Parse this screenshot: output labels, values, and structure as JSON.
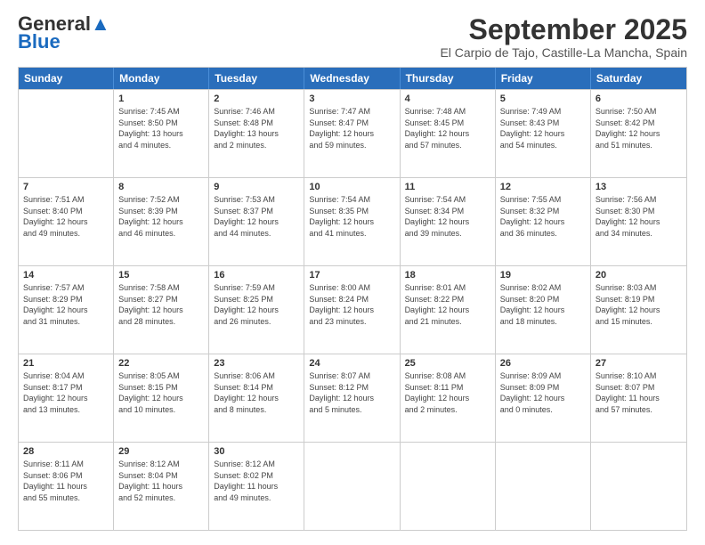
{
  "header": {
    "logo_line1": "General",
    "logo_line2": "Blue",
    "month": "September 2025",
    "location": "El Carpio de Tajo, Castille-La Mancha, Spain"
  },
  "days_of_week": [
    "Sunday",
    "Monday",
    "Tuesday",
    "Wednesday",
    "Thursday",
    "Friday",
    "Saturday"
  ],
  "weeks": [
    [
      {
        "day": "",
        "info": ""
      },
      {
        "day": "1",
        "info": "Sunrise: 7:45 AM\nSunset: 8:50 PM\nDaylight: 13 hours\nand 4 minutes."
      },
      {
        "day": "2",
        "info": "Sunrise: 7:46 AM\nSunset: 8:48 PM\nDaylight: 13 hours\nand 2 minutes."
      },
      {
        "day": "3",
        "info": "Sunrise: 7:47 AM\nSunset: 8:47 PM\nDaylight: 12 hours\nand 59 minutes."
      },
      {
        "day": "4",
        "info": "Sunrise: 7:48 AM\nSunset: 8:45 PM\nDaylight: 12 hours\nand 57 minutes."
      },
      {
        "day": "5",
        "info": "Sunrise: 7:49 AM\nSunset: 8:43 PM\nDaylight: 12 hours\nand 54 minutes."
      },
      {
        "day": "6",
        "info": "Sunrise: 7:50 AM\nSunset: 8:42 PM\nDaylight: 12 hours\nand 51 minutes."
      }
    ],
    [
      {
        "day": "7",
        "info": "Sunrise: 7:51 AM\nSunset: 8:40 PM\nDaylight: 12 hours\nand 49 minutes."
      },
      {
        "day": "8",
        "info": "Sunrise: 7:52 AM\nSunset: 8:39 PM\nDaylight: 12 hours\nand 46 minutes."
      },
      {
        "day": "9",
        "info": "Sunrise: 7:53 AM\nSunset: 8:37 PM\nDaylight: 12 hours\nand 44 minutes."
      },
      {
        "day": "10",
        "info": "Sunrise: 7:54 AM\nSunset: 8:35 PM\nDaylight: 12 hours\nand 41 minutes."
      },
      {
        "day": "11",
        "info": "Sunrise: 7:54 AM\nSunset: 8:34 PM\nDaylight: 12 hours\nand 39 minutes."
      },
      {
        "day": "12",
        "info": "Sunrise: 7:55 AM\nSunset: 8:32 PM\nDaylight: 12 hours\nand 36 minutes."
      },
      {
        "day": "13",
        "info": "Sunrise: 7:56 AM\nSunset: 8:30 PM\nDaylight: 12 hours\nand 34 minutes."
      }
    ],
    [
      {
        "day": "14",
        "info": "Sunrise: 7:57 AM\nSunset: 8:29 PM\nDaylight: 12 hours\nand 31 minutes."
      },
      {
        "day": "15",
        "info": "Sunrise: 7:58 AM\nSunset: 8:27 PM\nDaylight: 12 hours\nand 28 minutes."
      },
      {
        "day": "16",
        "info": "Sunrise: 7:59 AM\nSunset: 8:25 PM\nDaylight: 12 hours\nand 26 minutes."
      },
      {
        "day": "17",
        "info": "Sunrise: 8:00 AM\nSunset: 8:24 PM\nDaylight: 12 hours\nand 23 minutes."
      },
      {
        "day": "18",
        "info": "Sunrise: 8:01 AM\nSunset: 8:22 PM\nDaylight: 12 hours\nand 21 minutes."
      },
      {
        "day": "19",
        "info": "Sunrise: 8:02 AM\nSunset: 8:20 PM\nDaylight: 12 hours\nand 18 minutes."
      },
      {
        "day": "20",
        "info": "Sunrise: 8:03 AM\nSunset: 8:19 PM\nDaylight: 12 hours\nand 15 minutes."
      }
    ],
    [
      {
        "day": "21",
        "info": "Sunrise: 8:04 AM\nSunset: 8:17 PM\nDaylight: 12 hours\nand 13 minutes."
      },
      {
        "day": "22",
        "info": "Sunrise: 8:05 AM\nSunset: 8:15 PM\nDaylight: 12 hours\nand 10 minutes."
      },
      {
        "day": "23",
        "info": "Sunrise: 8:06 AM\nSunset: 8:14 PM\nDaylight: 12 hours\nand 8 minutes."
      },
      {
        "day": "24",
        "info": "Sunrise: 8:07 AM\nSunset: 8:12 PM\nDaylight: 12 hours\nand 5 minutes."
      },
      {
        "day": "25",
        "info": "Sunrise: 8:08 AM\nSunset: 8:11 PM\nDaylight: 12 hours\nand 2 minutes."
      },
      {
        "day": "26",
        "info": "Sunrise: 8:09 AM\nSunset: 8:09 PM\nDaylight: 12 hours\nand 0 minutes."
      },
      {
        "day": "27",
        "info": "Sunrise: 8:10 AM\nSunset: 8:07 PM\nDaylight: 11 hours\nand 57 minutes."
      }
    ],
    [
      {
        "day": "28",
        "info": "Sunrise: 8:11 AM\nSunset: 8:06 PM\nDaylight: 11 hours\nand 55 minutes."
      },
      {
        "day": "29",
        "info": "Sunrise: 8:12 AM\nSunset: 8:04 PM\nDaylight: 11 hours\nand 52 minutes."
      },
      {
        "day": "30",
        "info": "Sunrise: 8:12 AM\nSunset: 8:02 PM\nDaylight: 11 hours\nand 49 minutes."
      },
      {
        "day": "",
        "info": ""
      },
      {
        "day": "",
        "info": ""
      },
      {
        "day": "",
        "info": ""
      },
      {
        "day": "",
        "info": ""
      }
    ]
  ]
}
